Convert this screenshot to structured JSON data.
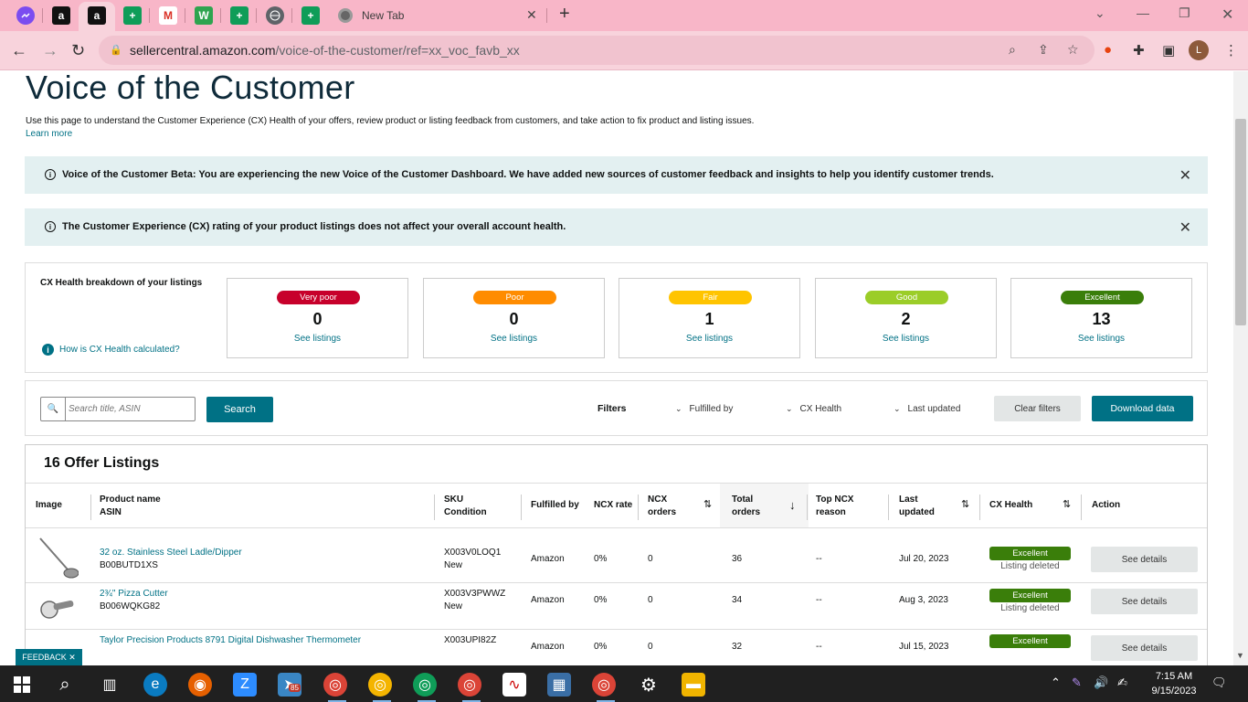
{
  "browser": {
    "tabs": [
      {
        "icon": "messenger-icon",
        "color": "#7b4cf0",
        "label": ""
      },
      {
        "icon": "amazon-icon",
        "color": "#111111",
        "label": "a"
      },
      {
        "icon": "amazon-icon",
        "color": "#111111",
        "label": "a"
      },
      {
        "icon": "sheets-icon",
        "color": "#0f9d58",
        "label": "+"
      },
      {
        "icon": "gmail-icon",
        "color": "#ffffff",
        "label": "M"
      },
      {
        "icon": "app-icon",
        "color": "#2ea44f",
        "label": "W"
      },
      {
        "icon": "sheets-icon",
        "color": "#0f9d58",
        "label": "+"
      },
      {
        "icon": "globe-icon",
        "color": "#5f6368",
        "label": ""
      },
      {
        "icon": "sheets-icon",
        "color": "#0f9d58",
        "label": "+"
      }
    ],
    "new_tab_title": "New Tab",
    "url_host": "sellercentral.amazon.com",
    "url_path": "/voice-of-the-customer/ref=xx_voc_favb_xx",
    "profile_initial": "L"
  },
  "page": {
    "title": "Voice of the Customer",
    "intro": "Use this page to understand the Customer Experience (CX) Health of your offers, review product or listing feedback from customers, and take action to fix product and listing issues.",
    "learn_more": "Learn more",
    "banner1": "Voice of the Customer Beta: You are experiencing the new Voice of the Customer Dashboard. We have added new sources of customer feedback and insights to help you identify customer trends.",
    "banner2": "The Customer Experience (CX) rating of your product listings does not affect your overall account health."
  },
  "cx": {
    "title": "CX Health breakdown of your listings",
    "how_link": "How is CX Health calculated?",
    "cards": [
      {
        "label": "Very poor",
        "count": "0",
        "link": "See listings",
        "color": "#c7002b"
      },
      {
        "label": "Poor",
        "count": "0",
        "link": "See listings",
        "color": "#ff8c00"
      },
      {
        "label": "Fair",
        "count": "1",
        "link": "See listings",
        "color": "#ffc400"
      },
      {
        "label": "Good",
        "count": "2",
        "link": "See listings",
        "color": "#9bcd28"
      },
      {
        "label": "Excellent",
        "count": "13",
        "link": "See listings",
        "color": "#3a7e0a"
      }
    ]
  },
  "filters": {
    "search_placeholder": "Search title, ASIN",
    "search_button": "Search",
    "filters_label": "Filters",
    "fulfilled_by": "Fulfilled by",
    "cx_health": "CX Health",
    "last_updated": "Last updated",
    "clear": "Clear filters",
    "download": "Download data"
  },
  "table": {
    "title": "16 Offer Listings",
    "headers": {
      "image": "Image",
      "product_name": "Product name",
      "asin": "ASIN",
      "sku": "SKU",
      "condition": "Condition",
      "fulfilled_by": "Fulfilled by",
      "ncx_rate": "NCX rate",
      "ncx_orders_1": "NCX",
      "ncx_orders_2": "orders",
      "total_orders_1": "Total",
      "total_orders_2": "orders",
      "top_ncx_1": "Top NCX",
      "top_ncx_2": "reason",
      "last_updated_1": "Last",
      "last_updated_2": "updated",
      "cx_health": "CX Health",
      "action": "Action"
    },
    "rows": [
      {
        "name": "32 oz. Stainless Steel Ladle/Dipper",
        "asin": "B00BUTD1XS",
        "sku": "X003V0LOQ1",
        "condition": "New",
        "fulfilled": "Amazon",
        "ncx_rate": "0%",
        "ncx_orders": "0",
        "total_orders": "36",
        "top_reason": "--",
        "last_updated": "Jul 20, 2023",
        "health": "Excellent",
        "health_sub": "Listing deleted",
        "action": "See details"
      },
      {
        "name": "2¾\" Pizza Cutter",
        "asin": "B006WQKG82",
        "sku": "X003V3PWWZ",
        "condition": "New",
        "fulfilled": "Amazon",
        "ncx_rate": "0%",
        "ncx_orders": "0",
        "total_orders": "34",
        "top_reason": "--",
        "last_updated": "Aug 3, 2023",
        "health": "Excellent",
        "health_sub": "Listing deleted",
        "action": "See details"
      },
      {
        "name": "Taylor Precision Products 8791 Digital Dishwasher Thermometer",
        "asin": "",
        "sku": "X003UPI82Z",
        "condition": "",
        "fulfilled": "Amazon",
        "ncx_rate": "0%",
        "ncx_orders": "0",
        "total_orders": "32",
        "top_reason": "--",
        "last_updated": "Jul 15, 2023",
        "health": "Excellent",
        "health_sub": "",
        "action": "See details"
      }
    ]
  },
  "feedback_label": "FEEDBACK ✕",
  "taskbar": {
    "time": "7:15 AM",
    "date": "9/15/2023",
    "badge": "85"
  }
}
